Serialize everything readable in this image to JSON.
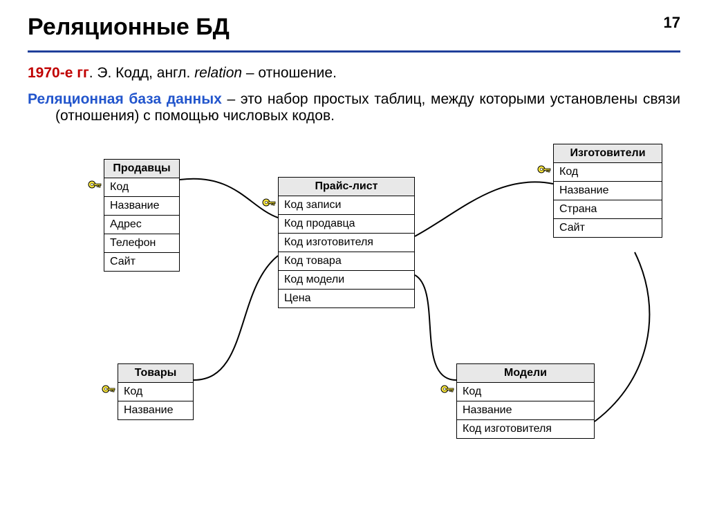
{
  "page_number": "17",
  "title": "Реляционные БД",
  "intro": {
    "prefix": "1970-е гг",
    "mid1": ". Э. Кодд, англ. ",
    "italic": "relation",
    "mid2": " – отношение."
  },
  "definition": {
    "term": "Реляционная база данных",
    "rest": " – это набор простых таблиц, между которыми установлены связи (отношения) с помощью числовых кодов."
  },
  "tables": {
    "sellers": {
      "header": "Продавцы",
      "rows": [
        "Код",
        "Название",
        "Адрес",
        "Телефон",
        "Сайт"
      ]
    },
    "pricelist": {
      "header": "Прайс-лист",
      "rows": [
        "Код записи",
        "Код продавца",
        "Код изготовителя",
        "Код товара",
        "Код модели",
        "Цена"
      ]
    },
    "manufacturers": {
      "header": "Изготовители",
      "rows": [
        "Код",
        "Название",
        "Страна",
        "Сайт"
      ]
    },
    "goods": {
      "header": "Товары",
      "rows": [
        "Код",
        "Название"
      ]
    },
    "models": {
      "header": "Модели",
      "rows": [
        "Код",
        "Название",
        "Код изготовителя"
      ]
    }
  }
}
